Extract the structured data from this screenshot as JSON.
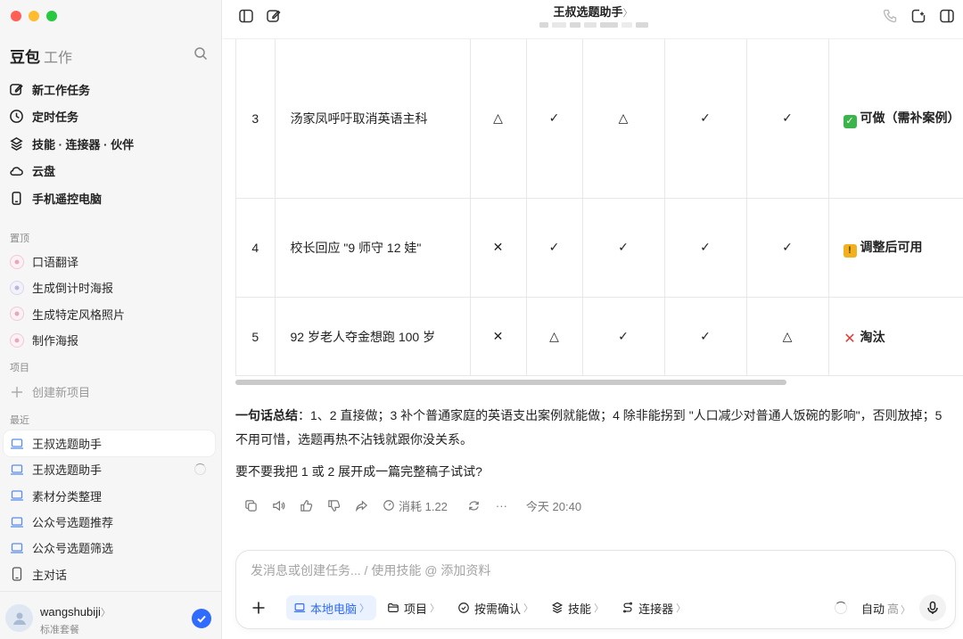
{
  "sidebar": {
    "brand": "豆包",
    "brand_sub": "工作",
    "nav": [
      {
        "label": "新工作任务",
        "icon": "edit-icon"
      },
      {
        "label": "定时任务",
        "icon": "clock-icon"
      },
      {
        "label": "技能 · 连接器 · 伙伴",
        "icon": "stack-icon"
      },
      {
        "label": "云盘",
        "icon": "cloud-icon"
      },
      {
        "label": "手机遥控电脑",
        "icon": "phone-icon"
      }
    ],
    "pinned_label": "置顶",
    "pinned": [
      "口语翻译",
      "生成倒计时海报",
      "生成特定风格照片",
      "制作海报"
    ],
    "projects_label": "项目",
    "create_project": "创建新项目",
    "recent_label": "最近",
    "recent": [
      "王叔选题助手",
      "王叔选题助手",
      "素材分类整理",
      "公众号选题推荐",
      "公众号选题筛选",
      "主对话"
    ],
    "user": {
      "name": "wangshubiji",
      "chevron": "〉",
      "plan": "标准套餐"
    }
  },
  "header": {
    "title": "王叔选题助手",
    "title_chevron": "〉"
  },
  "table": {
    "rows": [
      {
        "num": "3",
        "name": "汤家凤呼吁取消英语主科",
        "cells": [
          "△",
          "✓",
          "△",
          "✓",
          "✓"
        ],
        "result": "可做（需补案例）",
        "result_icon": "check-box-icon",
        "result_color": "#3bb54a",
        "result_glyph": "✓"
      },
      {
        "num": "4",
        "name": "校长回应 \"9 师守 12 娃\"",
        "cells": [
          "✕",
          "✓",
          "✓",
          "✓",
          "✓"
        ],
        "result": "调整后可用",
        "result_icon": "warning-icon",
        "result_color": "#f2b01e",
        "result_glyph": "!"
      },
      {
        "num": "5",
        "name": "92 岁老人夺金想跑 100 岁",
        "cells": [
          "✕",
          "△",
          "✓",
          "✓",
          "△"
        ],
        "result": "淘汰",
        "result_icon": "cross-icon",
        "result_color": "#e03b3b",
        "result_glyph": "✕"
      }
    ]
  },
  "summary": {
    "lead": "一句话总结",
    "text": "：1、2 直接做；3 补个普通家庭的英语支出案例就能做；4 除非能拐到 \"人口减少对普通人饭碗的影响\"，否则放掉；5 不用可惜，选题再热不沾钱就跟你没关系。",
    "question": "要不要我把 1 或 2 展开成一篇完整稿子试试?"
  },
  "actions": {
    "cost": "消耗 1.22",
    "time": "今天 20:40",
    "more": "···"
  },
  "composer": {
    "placeholder": "发消息或创建任务... / 使用技能 @ 添加资料",
    "chips": [
      {
        "label": "本地电脑",
        "icon": "laptop-icon"
      },
      {
        "label": "项目",
        "icon": "folder-icon"
      },
      {
        "label": "按需确认",
        "icon": "shield-check-icon"
      },
      {
        "label": "技能",
        "icon": "stack-icon"
      },
      {
        "label": "连接器",
        "icon": "connector-icon"
      }
    ],
    "mode": "自动",
    "level": "高"
  },
  "colors": {
    "accent": "#2f6bff",
    "red_dot": "#fe5f57",
    "yellow_dot": "#febc2e",
    "green_dot": "#28c840"
  }
}
